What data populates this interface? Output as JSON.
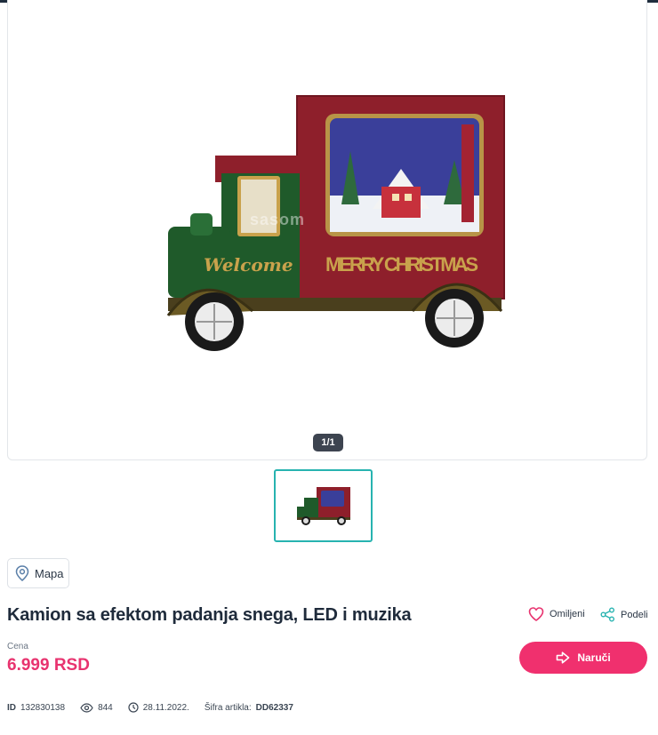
{
  "gallery": {
    "counter": "1/1",
    "watermark": "sasom",
    "image_alt": "truck-with-snow-scene",
    "image_text": {
      "left": "Welcome",
      "right": "MERRY CHRISTMAS"
    }
  },
  "map": {
    "label": "Mapa",
    "icon": "map-pin-icon"
  },
  "product": {
    "title": "Kamion sa efektom padanja snega, LED i muzika",
    "price_label": "Cena",
    "price": "6.999 RSD"
  },
  "actions": {
    "favorite_label": "Omiljeni",
    "share_label": "Podeli",
    "order_label": "Naruči"
  },
  "meta": {
    "id_key": "ID",
    "id_value": "132830138",
    "views": "844",
    "date": "28.11.2022.",
    "sku_key": "Šifra artikla:",
    "sku_value": "DD62337"
  },
  "colors": {
    "accent": "#f0306e",
    "price": "#e8336f",
    "thumb_border": "#27b3b0"
  }
}
